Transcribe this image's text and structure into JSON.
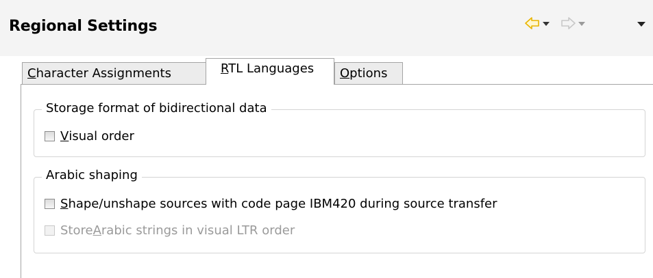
{
  "header": {
    "title": "Regional Settings",
    "back_color": "#e8b400",
    "forward_color": "#c8c8c8"
  },
  "tabs": [
    {
      "pre": "",
      "mnemonic": "C",
      "post": "haracter Assignments",
      "active": false
    },
    {
      "pre": "",
      "mnemonic": "R",
      "post": "TL Languages",
      "active": true
    },
    {
      "pre": "",
      "mnemonic": "O",
      "post": "ptions",
      "active": false
    }
  ],
  "storage_group": {
    "legend": "Storage format of bidirectional data",
    "visual_order": {
      "pre": "",
      "mnemonic": "V",
      "post": "isual order",
      "checked": false,
      "enabled": true
    }
  },
  "arabic_group": {
    "legend": "Arabic shaping",
    "shape": {
      "pre": "",
      "mnemonic": "S",
      "post": "hape/unshape sources with code page IBM420 during source transfer",
      "checked": false,
      "enabled": true
    },
    "store": {
      "pre": "Store ",
      "mnemonic": "A",
      "post": "rabic strings in visual LTR order",
      "checked": false,
      "enabled": false
    }
  }
}
